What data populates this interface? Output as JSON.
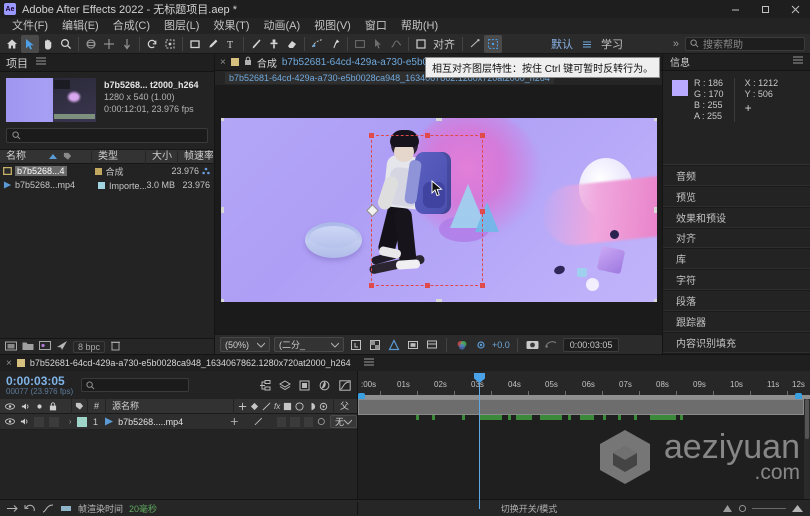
{
  "window": {
    "app_title": "Adobe After Effects 2022 - 无标题项目.aep *",
    "logo_text": "Ae",
    "minimize": "–",
    "maximize": "□",
    "close": "×"
  },
  "menubar": {
    "items": [
      {
        "label": "文件(F)"
      },
      {
        "label": "编辑(E)"
      },
      {
        "label": "合成(C)"
      },
      {
        "label": "图层(L)"
      },
      {
        "label": "效果(T)"
      },
      {
        "label": "动画(A)"
      },
      {
        "label": "视图(V)"
      },
      {
        "label": "窗口"
      },
      {
        "label": "帮助(H)"
      }
    ]
  },
  "toolbar": {
    "align_label": "对齐",
    "workspace_default": "默认",
    "workspace_learn": "学习",
    "overflow": "»",
    "search_placeholder": "搜索帮助"
  },
  "project": {
    "tab_title": "项目",
    "item_name": "b7b5268... t2000_h264",
    "resolution": "1280 x 540 (1.00)",
    "duration": "0:00:12:01, 23.976 fps",
    "search_placeholder": "",
    "columns": [
      "名称",
      "类型",
      "大小",
      "帧速率"
    ],
    "rows": [
      {
        "name": "b7b5268...4",
        "type": "合成",
        "size": "",
        "fps": "23.976",
        "selected": true
      },
      {
        "name": "b7b5268...mp4",
        "type": "Importe...义",
        "size": "3.0 MB",
        "fps": "23.976",
        "selected": false
      }
    ],
    "bit_depth": "8 bpc"
  },
  "composition": {
    "tab_prefix": "合成",
    "tab_id": "b7b52681-64cd-429a-a730-e5b0028ca948_163",
    "breadcrumb": "b7b52681-64cd-429a-a730-e5b0028ca948_1634067862.1280x720at2000_h264",
    "tooltip": "相互对齐图层特性：按住 Ctrl 键可暂时反转行为。",
    "zoom_level": "(50%)",
    "resolution_label": "(二分_",
    "exposure": "+0.0",
    "current_time": "0:00:03:05"
  },
  "info_panel": {
    "title": "信息",
    "r_label": "R :",
    "r_value": "186",
    "g_label": "G :",
    "g_value": "170",
    "b_label": "B :",
    "b_value": "255",
    "a_label": "A :",
    "a_value": "255",
    "x_label": "X :",
    "x_value": "1212",
    "y_label": "Y :",
    "y_value": "506",
    "swatch_color": "#baaaff"
  },
  "right_sections": [
    {
      "label": "音频"
    },
    {
      "label": "预览"
    },
    {
      "label": "效果和预设"
    },
    {
      "label": "对齐"
    },
    {
      "label": "库"
    },
    {
      "label": "字符"
    },
    {
      "label": "段落"
    },
    {
      "label": "跟踪器"
    },
    {
      "label": "内容识别填充"
    }
  ],
  "timeline": {
    "tab_name": "b7b52681-64cd-429a-a730-e5b0028ca948_1634067862.1280x720at2000_h264",
    "current_time": "0:00:03:05",
    "frames": "00077 (23.976 fps)",
    "search_placeholder": "",
    "columns": {
      "label": "#",
      "index": "#",
      "source_name": "源名称",
      "parent": "父级和链接"
    },
    "layers": [
      {
        "index": "1",
        "name": "b7b5268.....mp4",
        "parent": "无"
      }
    ],
    "ruler_labels": [
      ":00s",
      "01s",
      "02s",
      "03s",
      "04s",
      "05s",
      "06s",
      "07s",
      "08s",
      "09s",
      "10s",
      "11s",
      "12s"
    ],
    "render_time_label": "帧渲染时间",
    "render_time_value": "20毫秒",
    "switches_modes": "切换开关/模式"
  },
  "watermark": {
    "main": "aeziyuan",
    "sub": ".com"
  },
  "colors": {
    "accent_blue": "#6fa8dc",
    "selection_red": "#e04a4a",
    "panel_bg": "#232323"
  }
}
